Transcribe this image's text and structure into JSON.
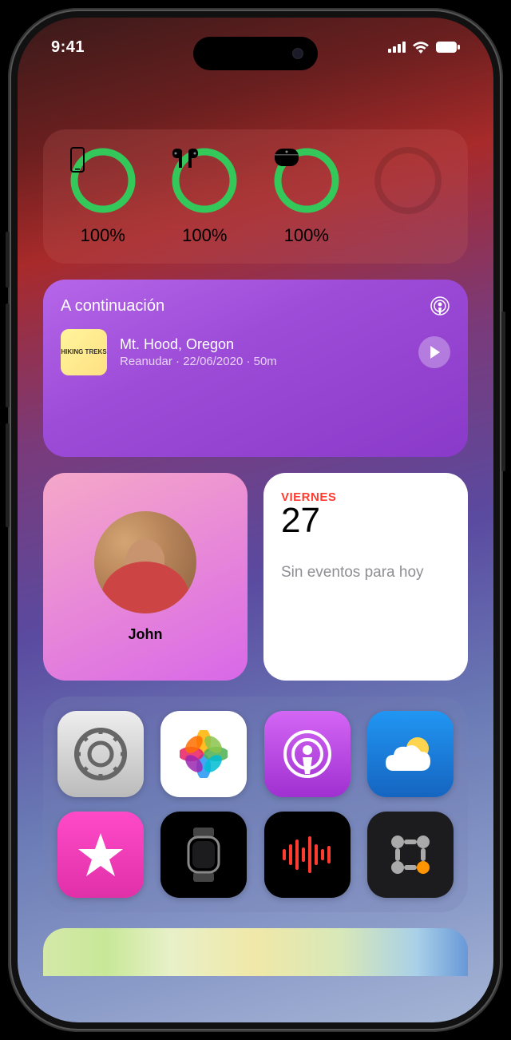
{
  "status": {
    "time": "9:41"
  },
  "battery": {
    "items": [
      {
        "pct": "100%",
        "icon": "phone"
      },
      {
        "pct": "100%",
        "icon": "airpods"
      },
      {
        "pct": "100%",
        "icon": "case"
      }
    ]
  },
  "podcast": {
    "header": "A continuación",
    "episode_title": "Mt. Hood, Oregon",
    "meta": "Reanudar · 22/06/2020 · 50m",
    "artwork_label": "HIKING TREKS"
  },
  "contact": {
    "name": "John"
  },
  "calendar": {
    "day_name": "VIERNES",
    "date": "27",
    "events": "Sin eventos para hoy"
  },
  "apps": {
    "row1": [
      "settings",
      "photos",
      "podcasts",
      "weather"
    ],
    "row2": [
      "itunes",
      "watch",
      "voice-memos",
      "calculator"
    ]
  }
}
